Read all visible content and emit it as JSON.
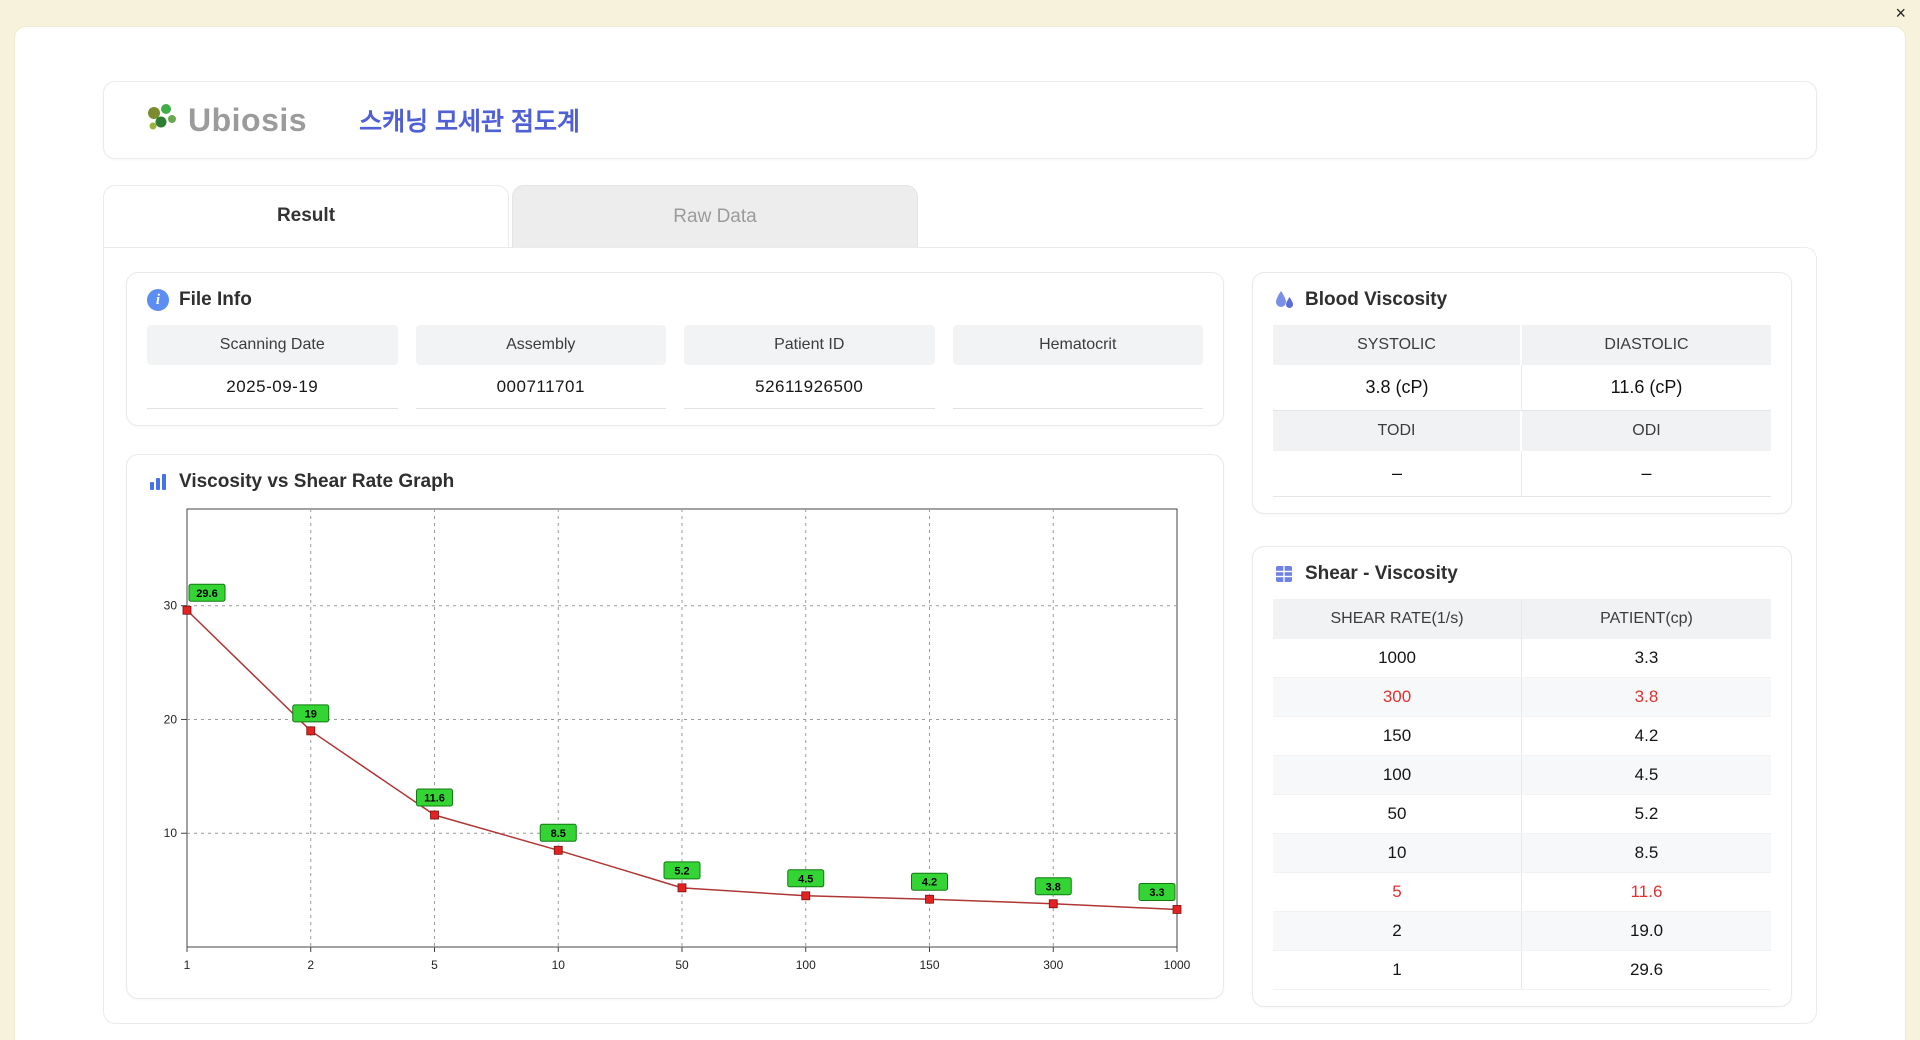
{
  "window": {
    "close_label": "×"
  },
  "header": {
    "logo_text": "Ubiosis",
    "title": "스캐닝 모세관 점도계"
  },
  "tabs": [
    {
      "label": "Result",
      "active": true
    },
    {
      "label": "Raw Data",
      "active": false
    }
  ],
  "file_info": {
    "heading": "File Info",
    "fields": [
      {
        "label": "Scanning Date",
        "value": "2025-09-19"
      },
      {
        "label": "Assembly",
        "value": "000711701"
      },
      {
        "label": "Patient ID",
        "value": "52611926500"
      },
      {
        "label": "Hematocrit",
        "value": ""
      }
    ]
  },
  "graph": {
    "heading": "Viscosity vs Shear Rate Graph"
  },
  "blood_viscosity": {
    "heading": "Blood Viscosity",
    "cells": [
      {
        "label": "SYSTOLIC",
        "value": "3.8 (cP)"
      },
      {
        "label": "DIASTOLIC",
        "value": "11.6 (cP)"
      },
      {
        "label": "TODI",
        "value": "–"
      },
      {
        "label": "ODI",
        "value": "–"
      }
    ]
  },
  "shear_viscosity": {
    "heading": "Shear - Viscosity",
    "columns": [
      "SHEAR RATE(1/s)",
      "PATIENT(cp)"
    ],
    "rows": [
      {
        "shear": "1000",
        "patient": "3.3",
        "highlight": false
      },
      {
        "shear": "300",
        "patient": "3.8",
        "highlight": true
      },
      {
        "shear": "150",
        "patient": "4.2",
        "highlight": false
      },
      {
        "shear": "100",
        "patient": "4.5",
        "highlight": false
      },
      {
        "shear": "50",
        "patient": "5.2",
        "highlight": false
      },
      {
        "shear": "10",
        "patient": "8.5",
        "highlight": false
      },
      {
        "shear": "5",
        "patient": "11.6",
        "highlight": true
      },
      {
        "shear": "2",
        "patient": "19.0",
        "highlight": false
      },
      {
        "shear": "1",
        "patient": "29.6",
        "highlight": false
      }
    ]
  },
  "chart_data": {
    "type": "line",
    "title": "Viscosity vs Shear Rate Graph",
    "x_categories": [
      "1",
      "2",
      "5",
      "10",
      "50",
      "100",
      "150",
      "300",
      "1000"
    ],
    "values": [
      29.6,
      19,
      11.6,
      8.5,
      5.2,
      4.5,
      4.2,
      3.8,
      3.3
    ],
    "point_labels": [
      "29.6",
      "19",
      "11.6",
      "8.5",
      "5.2",
      "4.5",
      "4.2",
      "3.8",
      "3.3"
    ],
    "y_ticks": [
      10,
      20,
      30
    ],
    "ylim": [
      0,
      38.5
    ],
    "grid": true,
    "legend": "none",
    "line_color": "#b03535",
    "marker_color": "#e32222",
    "label_bg": "#35d435",
    "label_border": "#117a11"
  },
  "colors": {
    "accent_blue": "#4f5fd5",
    "highlight_red": "#e03131",
    "panel_cream": "#f7f2db"
  }
}
